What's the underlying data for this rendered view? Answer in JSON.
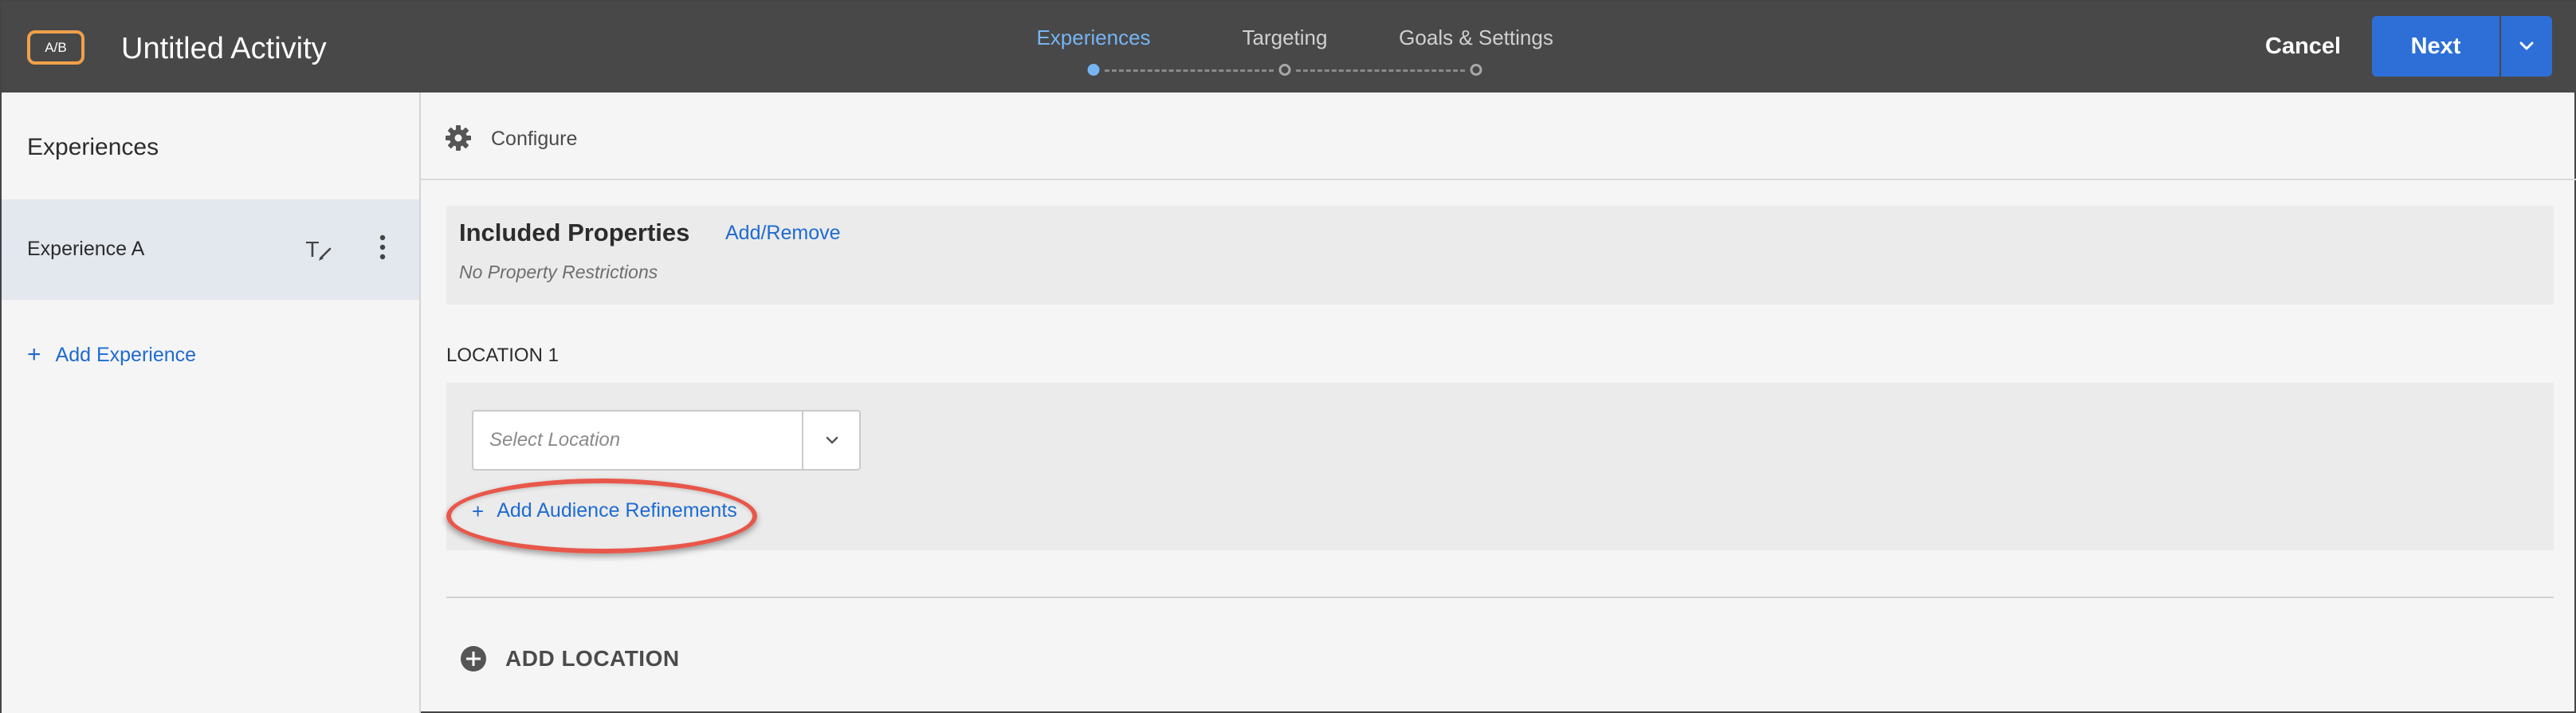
{
  "header": {
    "badge": "A/B",
    "title": "Untitled Activity",
    "steps": [
      {
        "label": "Experiences",
        "active": true
      },
      {
        "label": "Targeting",
        "active": false
      },
      {
        "label": "Goals & Settings",
        "active": false
      }
    ],
    "cancel_label": "Cancel",
    "next_label": "Next"
  },
  "sidebar": {
    "heading": "Experiences",
    "experiences": [
      {
        "name": "Experience A"
      }
    ],
    "add_experience_label": "Add Experience"
  },
  "main": {
    "configure_label": "Configure",
    "included_properties": {
      "title": "Included Properties",
      "action_label": "Add/Remove",
      "status": "No Property Restrictions"
    },
    "locations": [
      {
        "label": "LOCATION 1",
        "select_placeholder": "Select Location",
        "refinements_label": "Add Audience Refinements"
      }
    ],
    "add_location_label": "ADD LOCATION"
  },
  "colors": {
    "header_bg": "#484848",
    "accent": "#2d6fd6",
    "link": "#1f6bd0",
    "active_step": "#76b4f3",
    "badge_border": "#f0a04b",
    "highlight": "#e8574a"
  },
  "icons": {
    "configure": "gear-icon",
    "rename": "rename-icon",
    "more": "more-vertical-icon",
    "dropdown": "chevron-down-icon",
    "add_location": "plus-circle-icon"
  }
}
